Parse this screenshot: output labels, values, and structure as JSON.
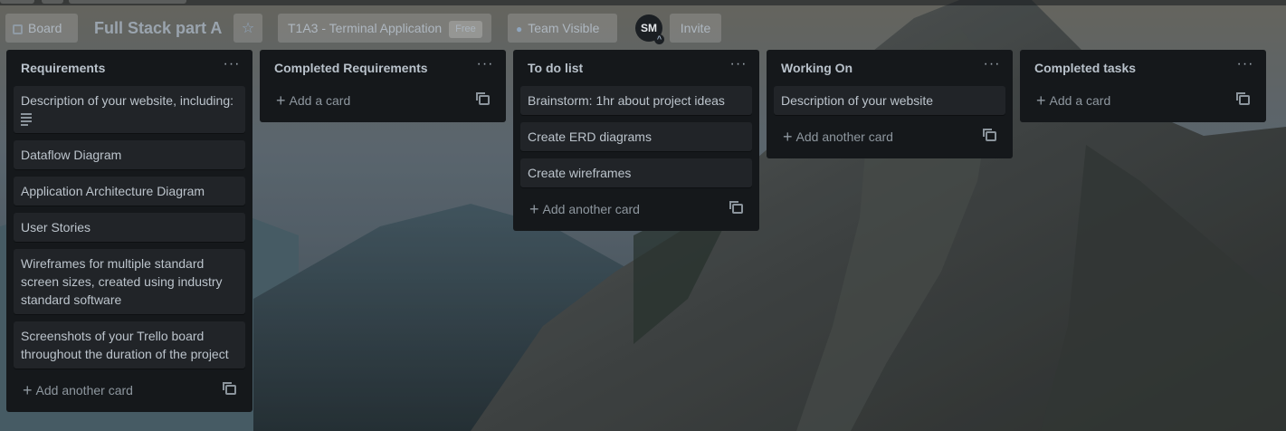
{
  "board": {
    "view_label": "Board",
    "title": "Full Stack part A",
    "workspace": "T1A3 - Terminal Application",
    "workspace_badge": "Free",
    "visibility": "Team Visible",
    "member_initials": "SM",
    "invite_label": "Invite"
  },
  "icons": {
    "board": "board-icon",
    "star": "star-icon",
    "visibility": "team-icon",
    "menu": "ellipsis-icon",
    "add": "plus-icon",
    "template": "card-template-icon",
    "description": "description-icon"
  },
  "lists": [
    {
      "title": "Requirements",
      "cards": [
        {
          "text": "Description of your website, including:",
          "has_description": true
        },
        {
          "text": "Dataflow Diagram"
        },
        {
          "text": "Application Architecture Diagram"
        },
        {
          "text": "User Stories"
        },
        {
          "text": "Wireframes for multiple standard screen sizes, created using industry standard software"
        },
        {
          "text": "Screenshots of your Trello board throughout the duration of the project"
        }
      ],
      "add_label": "Add another card"
    },
    {
      "title": "Completed Requirements",
      "cards": [],
      "add_label": "Add a card"
    },
    {
      "title": "To do list",
      "cards": [
        {
          "text": "Brainstorm: 1hr about project ideas"
        },
        {
          "text": "Create ERD diagrams"
        },
        {
          "text": "Create wireframes"
        }
      ],
      "add_label": "Add another card"
    },
    {
      "title": "Working On",
      "cards": [
        {
          "text": "Description of your website"
        }
      ],
      "add_label": "Add another card"
    },
    {
      "title": "Completed tasks",
      "cards": [],
      "add_label": "Add a card"
    }
  ],
  "colors": {
    "list_bg": "#15181b",
    "card_bg": "#212428",
    "text": "#bcc4cc"
  }
}
